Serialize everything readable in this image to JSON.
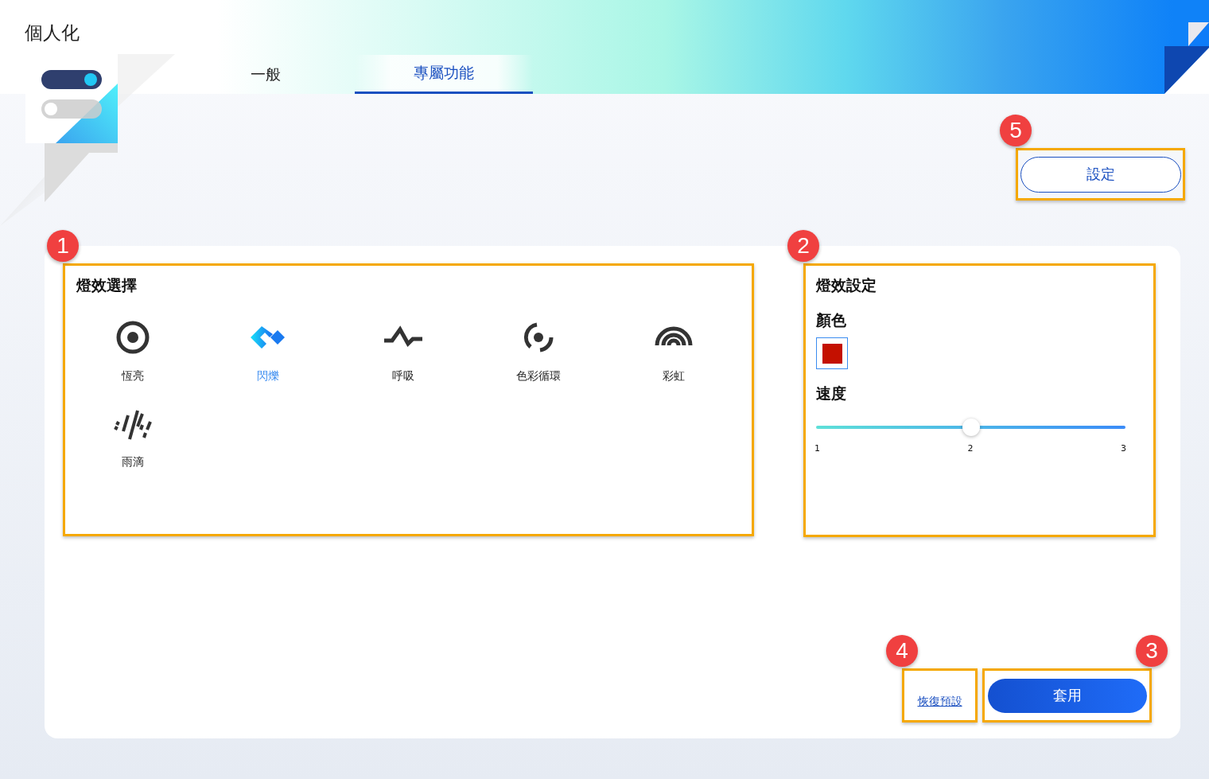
{
  "title": "個人化",
  "tabs": [
    {
      "label": "一般",
      "selected": false
    },
    {
      "label": "專屬功能",
      "selected": true
    }
  ],
  "settings_button": {
    "label": "設定",
    "callout": "5"
  },
  "effects_panel": {
    "title": "燈效選擇",
    "callout": "1",
    "effects": [
      {
        "kind": "static",
        "label": "恆亮",
        "selected": false
      },
      {
        "kind": "flash",
        "label": "閃爍",
        "selected": true
      },
      {
        "kind": "breathing",
        "label": "呼吸",
        "selected": false
      },
      {
        "kind": "color_cycle",
        "label": "色彩循環",
        "selected": false
      },
      {
        "kind": "rainbow",
        "label": "彩虹",
        "selected": false
      },
      {
        "kind": "raindrop",
        "label": "雨滴",
        "selected": false
      }
    ]
  },
  "lighting_settings": {
    "title": "燈效設定",
    "callout": "2",
    "color_label": "顏色",
    "color": "#c41000",
    "speed_label": "速度",
    "speed": {
      "level": 0.5,
      "ticks": [
        "1",
        "2",
        "3"
      ]
    }
  },
  "restore_default": {
    "label": "恢復預設",
    "callout": "4"
  },
  "apply_button": {
    "label": "套用",
    "callout": "3"
  }
}
